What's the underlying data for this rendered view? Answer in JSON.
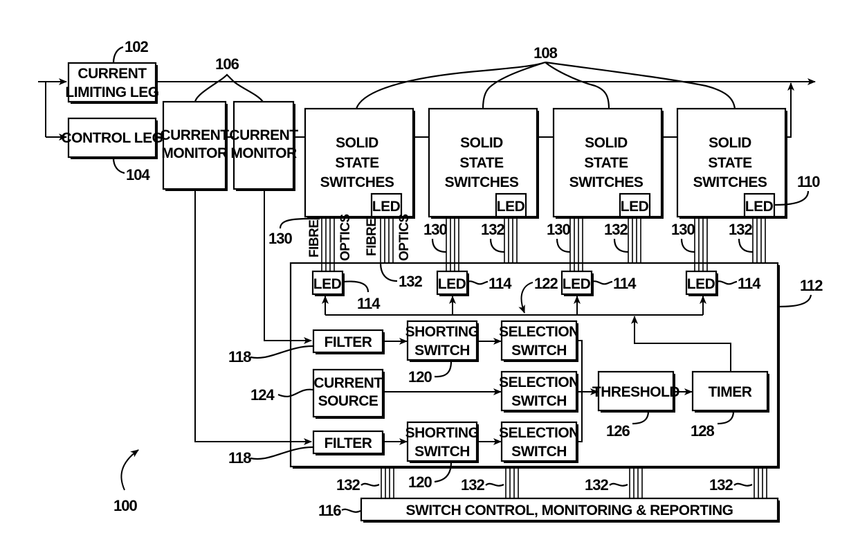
{
  "figure": {
    "reference": "100",
    "blocks": {
      "current_limiting_leg": {
        "lines": [
          "CURRENT",
          "LIMITING LEG"
        ],
        "ref": "102"
      },
      "control_leg": {
        "lines": [
          "CONTROL LEG"
        ],
        "ref": "104"
      },
      "current_monitor_1": {
        "lines": [
          "CURRENT",
          "MONITOR"
        ]
      },
      "current_monitor_2": {
        "lines": [
          "CURRENT",
          "MONITOR"
        ]
      },
      "current_monitor_group_ref": "106",
      "solid_state_switches": [
        {
          "lines": [
            "SOLID",
            "STATE",
            "SWITCHES"
          ],
          "led": "LED"
        },
        {
          "lines": [
            "SOLID",
            "STATE",
            "SWITCHES"
          ],
          "led": "LED"
        },
        {
          "lines": [
            "SOLID",
            "STATE",
            "SWITCHES"
          ],
          "led": "LED"
        },
        {
          "lines": [
            "SOLID",
            "STATE",
            "SWITCHES"
          ],
          "led": "LED"
        }
      ],
      "switch_group_ref": "108",
      "switch_led_ref": "110",
      "controller_ref": "112",
      "receiver_leds": [
        {
          "label": "LED",
          "ref": "114"
        },
        {
          "label": "LED",
          "ref": "114"
        },
        {
          "label": "LED",
          "ref": "114"
        },
        {
          "label": "LED",
          "ref": "114"
        }
      ],
      "fibre_labels": {
        "fibre": "FIBRE",
        "optics": "OPTICS"
      },
      "fibre_refs": {
        "to_led": "130",
        "to_control": "132"
      },
      "filter_1": {
        "label": "FILTER",
        "ref": "118"
      },
      "filter_2": {
        "label": "FILTER",
        "ref": "118"
      },
      "shorting_switch_1": {
        "lines": [
          "SHORTING",
          "SWITCH"
        ],
        "ref": "120"
      },
      "shorting_switch_2": {
        "lines": [
          "SHORTING",
          "SWITCH"
        ],
        "ref": "120"
      },
      "selection_switch_1": {
        "lines": [
          "SELECTION",
          "SWITCH"
        ]
      },
      "selection_switch_2": {
        "lines": [
          "SELECTION",
          "SWITCH"
        ]
      },
      "selection_switch_3": {
        "lines": [
          "SELECTION",
          "SWITCH"
        ]
      },
      "selection_ref": "122",
      "current_source": {
        "lines": [
          "CURRENT",
          "SOURCE"
        ],
        "ref": "124"
      },
      "threshold": {
        "label": "THRESHOLD",
        "ref": "126"
      },
      "timer": {
        "label": "TIMER",
        "ref": "128"
      },
      "switch_control": {
        "label": "SWITCH CONTROL, MONITORING & REPORTING",
        "ref": "116"
      },
      "bottom_fibre_ref": "132"
    }
  }
}
